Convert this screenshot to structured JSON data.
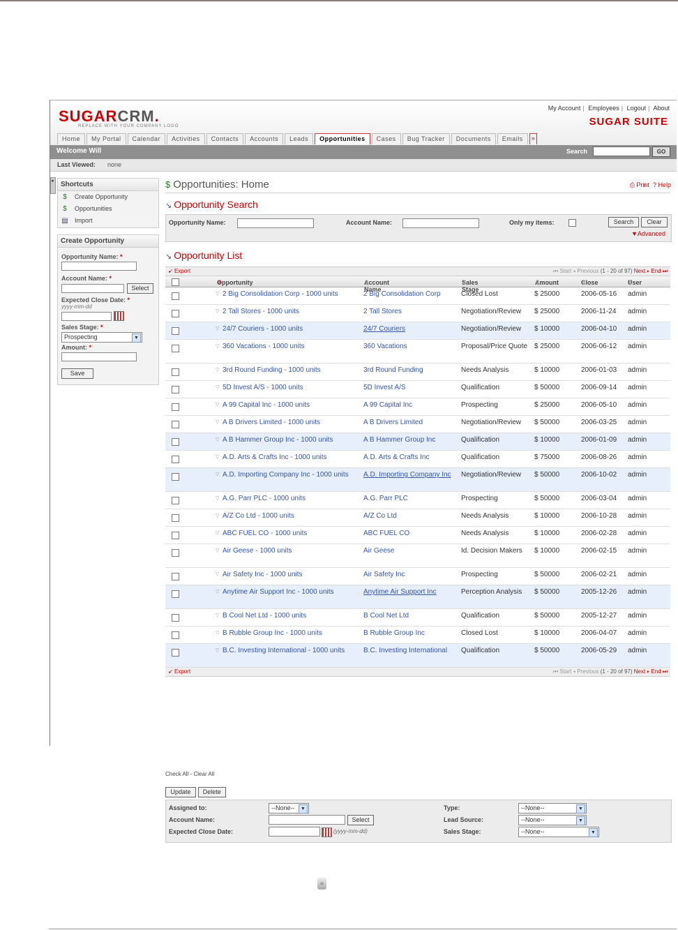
{
  "header": {
    "logo_red": "SUGAR",
    "logo_gray": "CRM",
    "logo_tm": ".",
    "tagline": "REPLACE WITH YOUR COMPANY LOGO",
    "toplinks": [
      "My Account",
      "Employees",
      "Logout",
      "About"
    ],
    "suite": "SUGAR SUITE",
    "tabs": [
      "Home",
      "My Portal",
      "Calendar",
      "Activities",
      "Contacts",
      "Accounts",
      "Leads",
      "Opportunities",
      "Cases",
      "Bug Tracker",
      "Documents",
      "Emails"
    ],
    "active_tab": "Opportunities",
    "more_tab": "»"
  },
  "welcome": {
    "text": "Welcome Will",
    "search_label": "Search",
    "go_label": "GO"
  },
  "last_viewed": {
    "label": "Last Viewed:",
    "value": "none"
  },
  "shortcuts": {
    "title": "Shortcuts",
    "items": [
      {
        "label": "Create Opportunity",
        "icon": "create-opportunity-icon"
      },
      {
        "label": "Opportunities",
        "icon": "opportunities-icon"
      },
      {
        "label": "Import",
        "icon": "import-icon"
      }
    ]
  },
  "create_form": {
    "title": "Create Opportunity",
    "opp_name_label": "Opportunity Name:",
    "account_label": "Account Name:",
    "select_label": "Select",
    "close_date_label": "Expected Close Date:",
    "date_format": "yyyy-mm-dd",
    "sales_stage_label": "Sales Stage:",
    "sales_stage_value": "Prospecting",
    "amount_label": "Amount:",
    "required_mark": "*",
    "save_label": "Save"
  },
  "page": {
    "title": "Opportunities: Home",
    "print": "Print",
    "help": "Help"
  },
  "search": {
    "title": "Opportunity Search",
    "opp_name_label": "Opportunity Name:",
    "account_label": "Account Name:",
    "only_mine_label": "Only my items:",
    "search_btn": "Search",
    "clear_btn": "Clear",
    "advanced": "Advanced"
  },
  "list": {
    "title": "Opportunity List",
    "export": "Export",
    "pager": {
      "start": "Start",
      "previous": "Previous",
      "range": "(1 - 20 of 97)",
      "next": "Next",
      "end": "End"
    },
    "columns": [
      "Opportunity",
      "Account Name",
      "Sales Stage",
      "Amount",
      "Close",
      "User"
    ],
    "rows": [
      {
        "opp": "2 Big Consolidation Corp - 1000 units",
        "acc": "2 Big Consolidation Corp",
        "stage": "Closed Lost",
        "amount": "$ 25000",
        "close": "2006-05-16",
        "user": "admin"
      },
      {
        "opp": "2 Tall Stores - 1000 units",
        "acc": "2 Tall Stores",
        "stage": "Negotiation/Review",
        "amount": "$ 25000",
        "close": "2006-11-24",
        "user": "admin"
      },
      {
        "opp": "24/7 Couriers - 1000 units",
        "acc": "24/7 Couriers",
        "stage": "Negotiation/Review",
        "amount": "$ 10000",
        "close": "2006-04-10",
        "user": "admin"
      },
      {
        "opp": "360 Vacations - 1000 units",
        "acc": "360 Vacations",
        "stage": "Proposal/Price Quote",
        "amount": "$ 25000",
        "close": "2006-06-12",
        "user": "admin"
      },
      {
        "opp": "3rd Round Funding - 1000 units",
        "acc": "3rd Round Funding",
        "stage": "Needs Analysis",
        "amount": "$ 10000",
        "close": "2006-01-03",
        "user": "admin"
      },
      {
        "opp": "5D Invest A/S - 1000 units",
        "acc": "5D Invest A/S",
        "stage": "Qualification",
        "amount": "$ 50000",
        "close": "2006-09-14",
        "user": "admin"
      },
      {
        "opp": "A 99 Capital Inc - 1000 units",
        "acc": "A 99 Capital Inc",
        "stage": "Prospecting",
        "amount": "$ 25000",
        "close": "2006-05-10",
        "user": "admin"
      },
      {
        "opp": "A B Drivers Limited - 1000 units",
        "acc": "A B Drivers Limited",
        "stage": "Negotiation/Review",
        "amount": "$ 50000",
        "close": "2006-03-25",
        "user": "admin"
      },
      {
        "opp": "A B Hammer Group Inc - 1000 units",
        "acc": "A B Hammer Group Inc",
        "stage": "Qualification",
        "amount": "$ 10000",
        "close": "2006-01-09",
        "user": "admin"
      },
      {
        "opp": "A.D. Arts & Crafts Inc - 1000 units",
        "acc": "A.D. Arts & Crafts Inc",
        "stage": "Qualification",
        "amount": "$ 75000",
        "close": "2006-08-26",
        "user": "admin"
      },
      {
        "opp": "A.D. Importing Company Inc - 1000 units",
        "acc": "A.D. Importing Company Inc",
        "stage": "Negotiation/Review",
        "amount": "$ 50000",
        "close": "2006-10-02",
        "user": "admin"
      },
      {
        "opp": "A.G. Parr PLC - 1000 units",
        "acc": "A.G. Parr PLC",
        "stage": "Prospecting",
        "amount": "$ 50000",
        "close": "2006-03-04",
        "user": "admin"
      },
      {
        "opp": "A/Z Co Ltd - 1000 units",
        "acc": "A/Z Co Ltd",
        "stage": "Needs Analysis",
        "amount": "$ 10000",
        "close": "2006-10-28",
        "user": "admin"
      },
      {
        "opp": "ABC FUEL CO - 1000 units",
        "acc": "ABC FUEL CO",
        "stage": "Needs Analysis",
        "amount": "$ 10000",
        "close": "2006-02-28",
        "user": "admin"
      },
      {
        "opp": "Air Geese - 1000 units",
        "acc": "Air Geese",
        "stage": "Id. Decision Makers",
        "amount": "$ 10000",
        "close": "2006-02-15",
        "user": "admin"
      },
      {
        "opp": "Air Safety Inc - 1000 units",
        "acc": "Air Safety Inc",
        "stage": "Prospecting",
        "amount": "$ 50000",
        "close": "2006-02-21",
        "user": "admin"
      },
      {
        "opp": "Anytime Air Support Inc - 1000 units",
        "acc": "Anytime Air Support Inc",
        "stage": "Perception Analysis",
        "amount": "$ 50000",
        "close": "2005-12-26",
        "user": "admin"
      },
      {
        "opp": "B Cool Net Ltd - 1000 units",
        "acc": "B Cool Net Ltd",
        "stage": "Qualification",
        "amount": "$ 50000",
        "close": "2005-12-27",
        "user": "admin"
      },
      {
        "opp": "B Rubble Group Inc - 1000 units",
        "acc": "B Rubble Group Inc",
        "stage": "Closed Lost",
        "amount": "$ 10000",
        "close": "2006-04-07",
        "user": "admin"
      },
      {
        "opp": "B.C. Investing International - 1000 units",
        "acc": "B.C. Investing International",
        "stage": "Qualification",
        "amount": "$ 50000",
        "close": "2006-05-29",
        "user": "admin"
      }
    ],
    "check_all": "Check All",
    "clear_all": "Clear All",
    "separator": "-",
    "update_btn": "Update",
    "delete_btn": "Delete"
  },
  "mass_update": {
    "assigned_label": "Assigned to:",
    "assigned_value": "--None--",
    "account_label": "Account Name:",
    "select_label": "Select",
    "close_label": "Expected Close Date:",
    "date_format": "(yyyy-mm-dd)",
    "type_label": "Type:",
    "type_value": "--None--",
    "lead_label": "Lead Source:",
    "lead_value": "--None--",
    "stage_label": "Sales Stage:",
    "stage_value": "--None--"
  }
}
